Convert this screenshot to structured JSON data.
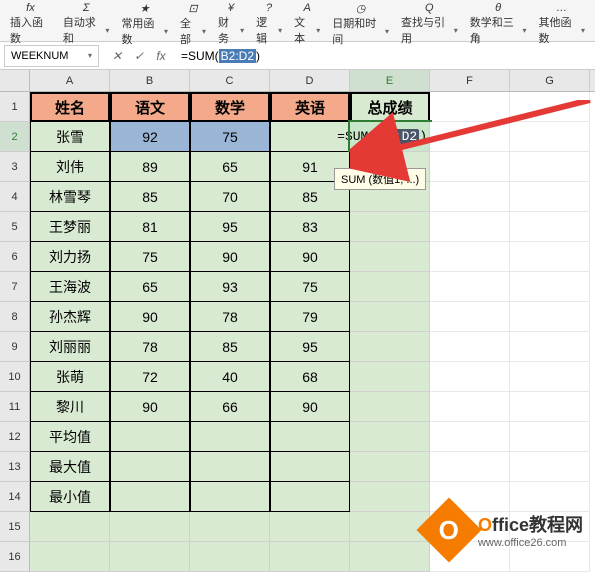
{
  "ribbon": {
    "items": [
      {
        "icon": "fx",
        "label": "插入函数"
      },
      {
        "icon": "Σ",
        "label": "自动求和"
      },
      {
        "icon": "★",
        "label": "常用函数"
      },
      {
        "icon": "?",
        "label": "全部"
      },
      {
        "icon": "¥",
        "label": "财务"
      },
      {
        "icon": "?",
        "label": "逻辑"
      },
      {
        "icon": "A",
        "label": "文本"
      },
      {
        "icon": "◷",
        "label": "日期和时间"
      },
      {
        "icon": "Q",
        "label": "查找与引用"
      },
      {
        "icon": "θ",
        "label": "数学和三角"
      },
      {
        "icon": "…",
        "label": "其他函数"
      }
    ]
  },
  "nameBox": "WEEKNUM",
  "formulaBar": {
    "prefix": "=SUM(",
    "range": "B2:D2",
    "suffix": ")"
  },
  "columns": [
    "A",
    "B",
    "C",
    "D",
    "E",
    "F",
    "G"
  ],
  "headerRow": [
    "姓名",
    "语文",
    "数学",
    "英语",
    "总成绩"
  ],
  "rows": [
    {
      "n": "1"
    },
    {
      "n": "2",
      "name": "张雪",
      "vals": [
        "92",
        "75",
        ""
      ],
      "edit": true
    },
    {
      "n": "3",
      "name": "刘伟",
      "vals": [
        "89",
        "65",
        "91"
      ]
    },
    {
      "n": "4",
      "name": "林雪琴",
      "vals": [
        "85",
        "70",
        "85"
      ]
    },
    {
      "n": "5",
      "name": "王梦丽",
      "vals": [
        "81",
        "95",
        "83"
      ]
    },
    {
      "n": "6",
      "name": "刘力扬",
      "vals": [
        "75",
        "90",
        "90"
      ]
    },
    {
      "n": "7",
      "name": "王海波",
      "vals": [
        "65",
        "93",
        "75"
      ]
    },
    {
      "n": "8",
      "name": "孙杰辉",
      "vals": [
        "90",
        "78",
        "79"
      ]
    },
    {
      "n": "9",
      "name": "刘丽丽",
      "vals": [
        "78",
        "85",
        "95"
      ]
    },
    {
      "n": "10",
      "name": "张萌",
      "vals": [
        "72",
        "40",
        "68"
      ]
    },
    {
      "n": "11",
      "name": "黎川",
      "vals": [
        "90",
        "66",
        "90"
      ]
    },
    {
      "n": "12",
      "name": "平均值",
      "vals": [
        "",
        "",
        ""
      ]
    },
    {
      "n": "13",
      "name": "最大值",
      "vals": [
        "",
        "",
        ""
      ]
    },
    {
      "n": "14",
      "name": "最小值",
      "vals": [
        "",
        "",
        ""
      ]
    },
    {
      "n": "15"
    },
    {
      "n": "16"
    }
  ],
  "editFormula": {
    "prefix": "=SUM(",
    "range": "B2:D2",
    "suffix": ")"
  },
  "tooltip": "SUM (数值1, ...)",
  "watermark": {
    "badge": "O",
    "titlePrefix": "O",
    "titleRest": "ffice教程网",
    "url": "www.office26.com"
  }
}
